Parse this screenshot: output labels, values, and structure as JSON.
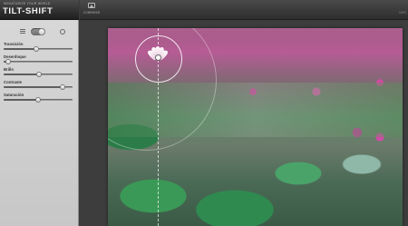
{
  "app": {
    "subtitle": "MINIATURIZE YOUR WORLD",
    "title": "TILT-SHIFT"
  },
  "toolbar": {
    "compare_label": "COMPARAR",
    "right_label": "INFO"
  },
  "mode": {
    "left_icon": "linear-icon",
    "right_icon": "radial-icon",
    "selected": "radial"
  },
  "controls": [
    {
      "label": "Transición",
      "value": 0.47
    },
    {
      "label": "Desenfoque",
      "value": 0.06
    },
    {
      "label": "Brillo",
      "value": 0.51
    },
    {
      "label": "Contraste",
      "value": 0.86
    },
    {
      "label": "Saturación",
      "value": 0.5
    }
  ],
  "colors": {
    "sidebar": "#d0d0d0",
    "toolbar": "#3a3a3a",
    "canvas": "#3d3d3d",
    "slider_fill": "#5e5e5e"
  }
}
